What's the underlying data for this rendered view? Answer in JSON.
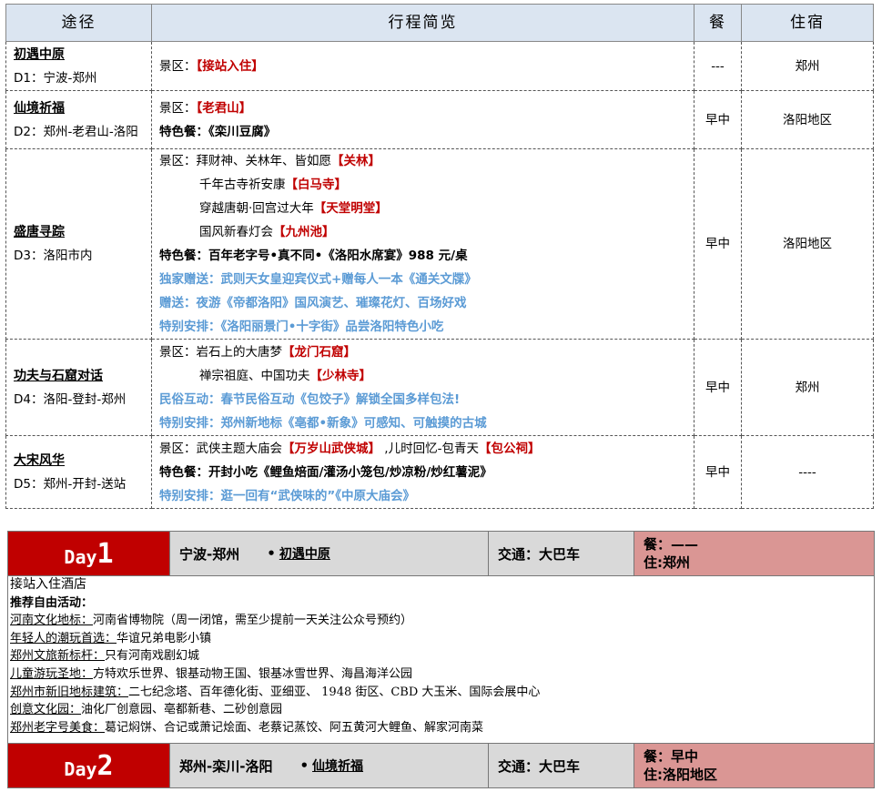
{
  "table": {
    "headers": {
      "route": "途径",
      "itinerary": "行程简览",
      "meal": "餐",
      "stay": "住宿"
    },
    "rows": [
      {
        "title": "初遇中原",
        "day": "D1：宁波-郑州",
        "lines": [
          {
            "a": "景区：",
            "b": "【接站入住】"
          }
        ],
        "meal": "---",
        "stay": "郑州"
      },
      {
        "title": "仙境祈福",
        "day": "D2：郑州-老君山-洛阳",
        "line1": {
          "a": "景区：",
          "b": "【老君山】"
        },
        "line2": "特色餐：《栾川豆腐》",
        "meal": "早中",
        "stay": "洛阳地区"
      },
      {
        "title": "盛唐寻踪",
        "day": "D3：洛阳市内",
        "l1": {
          "a": "景区：拜财神、关林年、皆如愿",
          "b": "【关林】"
        },
        "l2": {
          "a": "千年古寺祈安康",
          "b": "【白马寺】"
        },
        "l3": {
          "a": "穿越唐朝·回宫过大年",
          "b": "【天堂明堂】"
        },
        "l4": {
          "a": "国风新春灯会",
          "b": "【九州池】"
        },
        "l5": "特色餐：百年老字号•真不同•《洛阳水席宴》988 元/桌",
        "l6": "独家赠送：武则天女皇迎宾仪式+赠每人一本《通关文牒》",
        "l7": "赠送：夜游《帝都洛阳》国风演艺、璀璨花灯、百场好戏",
        "l8": "特别安排：《洛阳丽景门•十字街》品尝洛阳特色小吃",
        "meal": "早中",
        "stay": "洛阳地区"
      },
      {
        "title": "功夫与石窟对话",
        "day": "D4：洛阳-登封-郑州",
        "l1": {
          "a": "景区：岩石上的大唐梦",
          "b": "【龙门石窟】"
        },
        "l2": {
          "a": "禅宗祖庭、中国功夫",
          "b": "【少林寺】"
        },
        "l3": "民俗互动：春节民俗互动《包饺子》解锁全国多样包法!",
        "l4": "特别安排：郑州新地标《亳都•新象》可感知、可触摸的古城",
        "meal": "早中",
        "stay": "郑州"
      },
      {
        "title": "大宋风华",
        "day": "D5：郑州-开封-送站",
        "l1": {
          "a": "景区：武侠主题大庙会",
          "b": "【万岁山武侠城】",
          "c": " ,儿时回忆-包青天",
          "d": "【包公祠】"
        },
        "l2": "特色餐：开封小吃《鲤鱼焙面/灌汤小笼包/炒凉粉/炒红薯泥》",
        "l3": "特别安排：逛一回有“武侠味的”《中原大庙会》",
        "meal": "早中",
        "stay": "----"
      }
    ]
  },
  "day1": {
    "word": "Day",
    "num": "1",
    "route": "宁波-郑州",
    "dot": "•",
    "theme": "初遇中原",
    "transport": "交通：大巴车",
    "meal": "餐：——",
    "stay": "住:郑州",
    "lead": "接站入住酒店",
    "sub": "推荐自由活动：",
    "items": [
      {
        "k": "河南文化地标：",
        "v": "河南省博物院（周一闭馆，需至少提前一天关注公众号预约）"
      },
      {
        "k": "年轻人的潮玩首选：",
        "v": "华谊兄弟电影小镇"
      },
      {
        "k": "郑州文旅新标杆：",
        "v": "只有河南戏剧幻城"
      },
      {
        "k": "儿童游玩圣地：",
        "v": "方特欢乐世界、银基动物王国、银基冰雪世界、海昌海洋公园"
      },
      {
        "k": "郑州市新旧地标建筑：",
        "v": "二七纪念塔、百年德化街、亚细亚、 1948 街区、CBD 大玉米、国际会展中心"
      },
      {
        "k": "创意文化园：",
        "v": "油化厂创意园、亳都新巷、二砂创意园"
      },
      {
        "k": "郑州老字号美食：",
        "v": "葛记焖饼、合记或萧记烩面、老蔡记蒸饺、阿五黄河大鲤鱼、解家河南菜"
      }
    ]
  },
  "day2": {
    "word": "Day",
    "num": "2",
    "route": "郑州-栾川-洛阳",
    "dot": "•",
    "theme": "仙境祈福",
    "transport": "交通：大巴车",
    "meal": "餐：早中",
    "stay": "住:洛阳地区"
  }
}
